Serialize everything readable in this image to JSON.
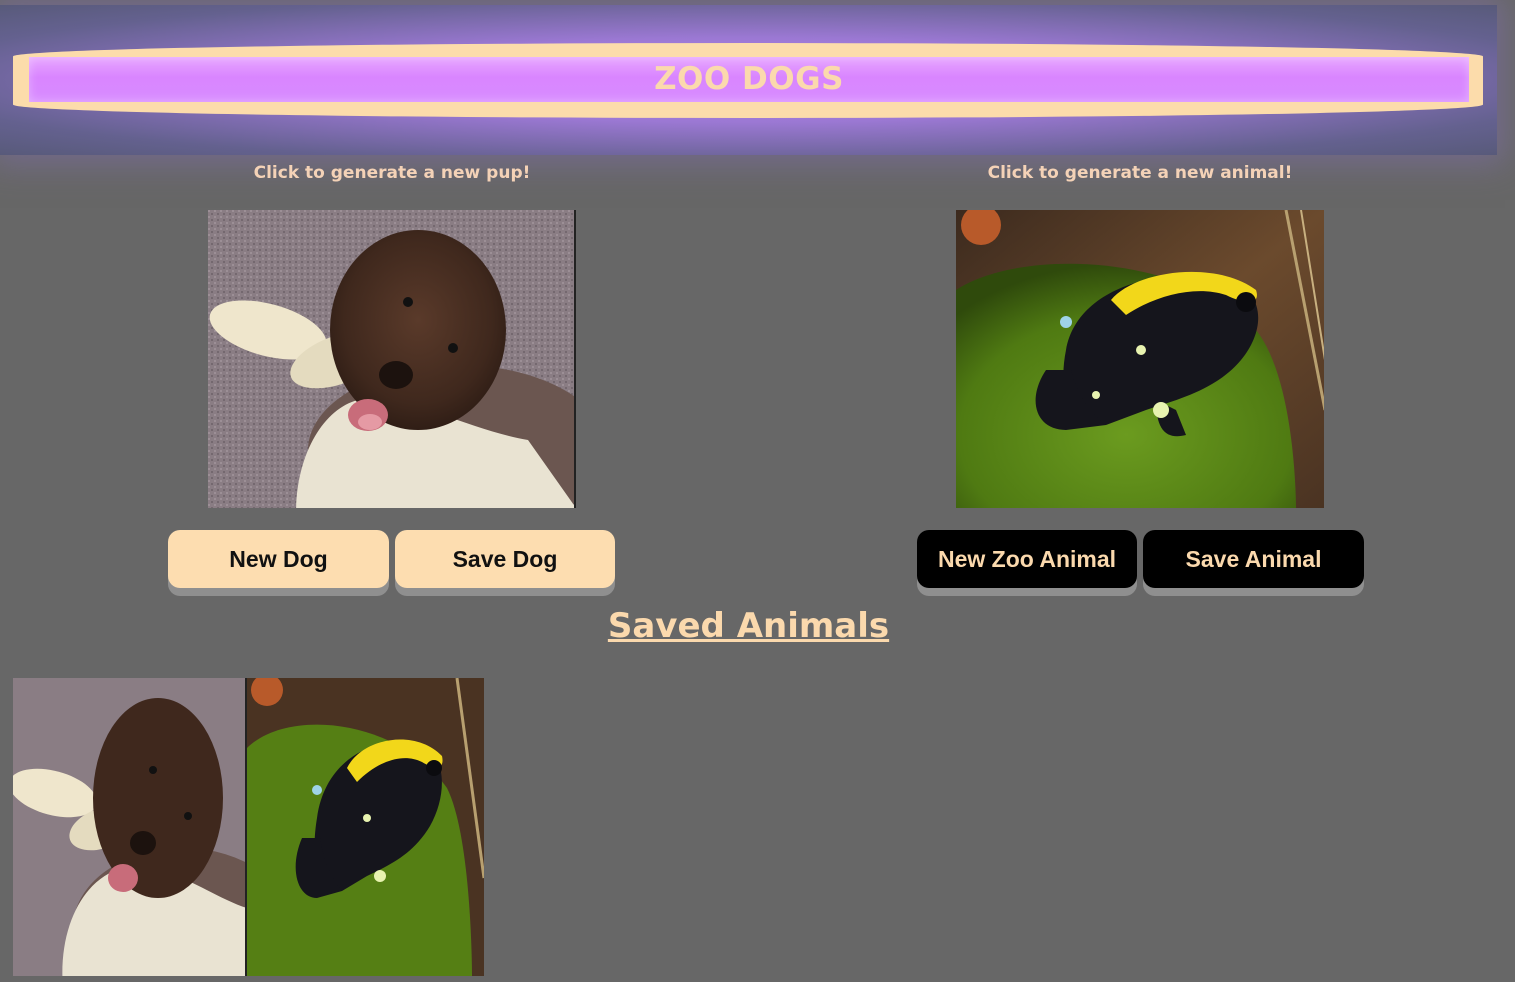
{
  "header": {
    "title": "ZOO DOGS"
  },
  "dog_panel": {
    "caption": "Click to generate a new pup!",
    "image_alt": "brown and white curly dog lying on carpet",
    "new_button": "New Dog",
    "save_button": "Save Dog"
  },
  "animal_panel": {
    "caption": "Click to generate a new animal!",
    "image_alt": "black and yellow poison dart frog on moss",
    "new_button": "New Zoo Animal",
    "save_button": "Save Animal"
  },
  "saved": {
    "title": "Saved Animals",
    "items": [
      {
        "alt": "saved dog"
      },
      {
        "alt": "saved frog"
      }
    ]
  },
  "colors": {
    "background": "#676767",
    "accent_peach": "#fdddb0",
    "header_purple": "#d985ff"
  }
}
